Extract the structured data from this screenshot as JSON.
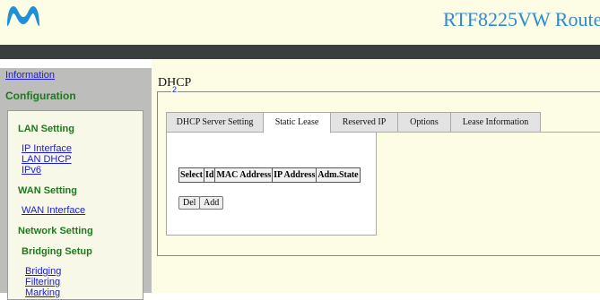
{
  "header": {
    "device_name": "RTF8225VW Route"
  },
  "sidebar": {
    "information": "Information",
    "configuration": "Configuration",
    "sections": {
      "lan": {
        "title": "LAN Setting",
        "items": [
          "IP Interface",
          "LAN DHCP",
          "IPv6"
        ]
      },
      "wan": {
        "title": "WAN Setting",
        "items": [
          "WAN Interface"
        ]
      },
      "network": {
        "title": "Network Setting"
      },
      "bridging": {
        "title": "Bridging Setup",
        "items": [
          "Bridging",
          "Filtering",
          "Marking"
        ]
      }
    }
  },
  "main": {
    "title": "DHCP",
    "legend_number": "2",
    "tabs": [
      {
        "label": "DHCP Server Setting",
        "active": false
      },
      {
        "label": "Static Lease",
        "active": true
      },
      {
        "label": "Reserved IP",
        "active": false
      },
      {
        "label": "Options",
        "active": false
      },
      {
        "label": "Lease Information",
        "active": false
      }
    ],
    "table_headers": [
      "Select",
      "Id",
      "MAC Address",
      "IP Address",
      "Adm.State"
    ],
    "buttons": {
      "del": "Del",
      "add": "Add"
    }
  },
  "colors": {
    "brand_blue": "#2a8bd6",
    "cream": "#fdfde6",
    "dark_bar": "#3b3e3f",
    "sidebar_gray": "#bdbdbb",
    "section_green": "#1c7a1c",
    "link_blue": "#1a1ae0"
  },
  "icons": {
    "logo": "movistar-m-logo"
  }
}
